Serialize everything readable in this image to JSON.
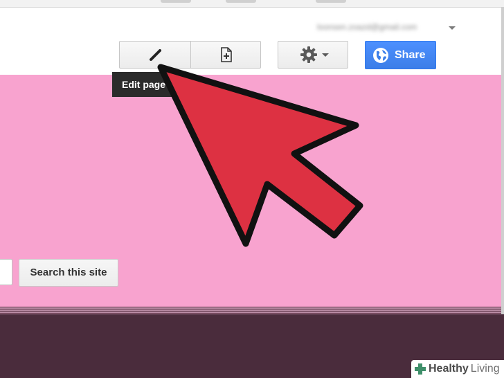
{
  "header": {
    "account_email": "loonsen.zoazd@gmail.com"
  },
  "toolbar": {
    "edit_page_tooltip": "Edit page",
    "share_label": "Share"
  },
  "search": {
    "input_value": "",
    "button_label": "Search this site"
  },
  "watermark": {
    "brand_bold": "Healthy",
    "brand_light": "Living"
  },
  "colors": {
    "header_bg": "#f8a3cf",
    "footer_bg": "#4a2c3c",
    "share_button": "#4d90fe",
    "tooltip_bg": "#2b2b2b",
    "pointer_fill": "#dd3142"
  },
  "icons": {
    "edit": "pencil-icon",
    "new_page": "new-page-icon",
    "settings": "gear-icon",
    "share": "globe-icon",
    "account_menu": "caret-down-icon",
    "pointer": "red-arrow-pointer"
  }
}
